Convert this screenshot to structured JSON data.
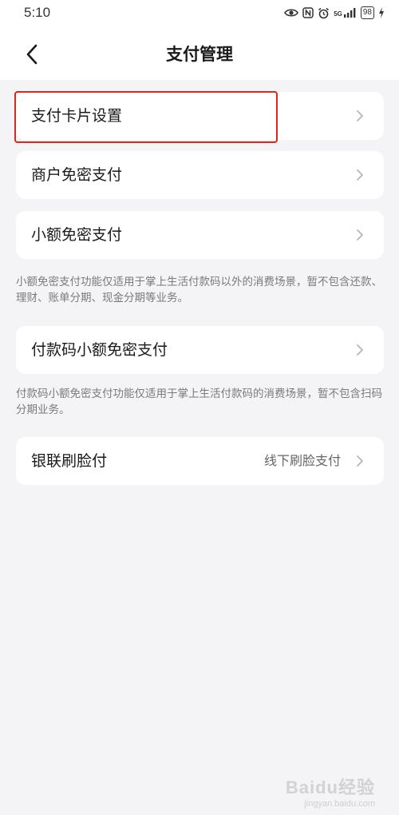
{
  "status_bar": {
    "time": "5:10",
    "network": "5G",
    "battery": "98"
  },
  "header": {
    "title": "支付管理"
  },
  "items": [
    {
      "label": "支付卡片设置"
    },
    {
      "label": "商户免密支付"
    },
    {
      "label": "小额免密支付"
    },
    {
      "label": "付款码小额免密支付"
    },
    {
      "label": "银联刷脸付",
      "value": "线下刷脸支付"
    }
  ],
  "notes": {
    "small_amount": "小额免密支付功能仅适用于掌上生活付款码以外的消费场景，暂不包含还款、理财、账单分期、现金分期等业务。",
    "payment_code": "付款码小额免密支付功能仅适用于掌上生活付款码的消费场景，暂不包含扫码分期业务。"
  },
  "watermark": {
    "main": "Baidu经验",
    "sub": "jingyan.baidu.com"
  },
  "colors": {
    "highlight": "#e0251b",
    "background": "#f4f4f6"
  },
  "icons": [
    "back-arrow-icon",
    "chevron-right-icon",
    "eye-icon",
    "nfc-icon",
    "alarm-icon",
    "signal-icon",
    "battery-icon",
    "charging-icon"
  ]
}
